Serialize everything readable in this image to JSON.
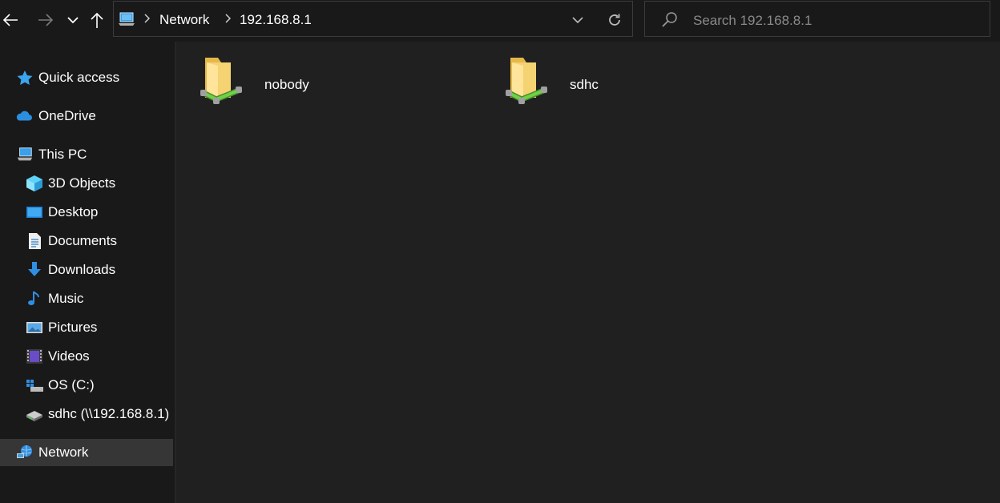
{
  "nav": {
    "back_icon": "back-arrow-icon",
    "forward_icon": "forward-arrow-icon",
    "recent_icon": "chevron-down-icon",
    "up_icon": "up-arrow-icon"
  },
  "address": {
    "icon": "network-pc-icon",
    "breadcrumbs": [
      "Network",
      "192.168.8.1"
    ],
    "dropdown_icon": "chevron-down-icon",
    "refresh_icon": "refresh-icon"
  },
  "search": {
    "placeholder": "Search 192.168.8.1",
    "icon": "search-icon"
  },
  "sidebar": {
    "items": [
      {
        "label": "Quick access",
        "icon": "star-icon"
      },
      {
        "label": "OneDrive",
        "icon": "cloud-icon"
      },
      {
        "label": "This PC",
        "icon": "computer-icon"
      },
      {
        "label": "3D Objects",
        "icon": "cube-icon"
      },
      {
        "label": "Desktop",
        "icon": "desktop-icon"
      },
      {
        "label": "Documents",
        "icon": "document-icon"
      },
      {
        "label": "Downloads",
        "icon": "download-icon"
      },
      {
        "label": "Music",
        "icon": "music-note-icon"
      },
      {
        "label": "Pictures",
        "icon": "pictures-icon"
      },
      {
        "label": "Videos",
        "icon": "film-icon"
      },
      {
        "label": "OS (C:)",
        "icon": "drive-icon"
      },
      {
        "label": "sdhc (\\\\192.168.8.1)",
        "icon": "network-drive-icon"
      },
      {
        "label": "Network",
        "icon": "network-globe-icon",
        "selected": true
      }
    ]
  },
  "content": {
    "items": [
      {
        "name": "nobody",
        "icon": "shared-folder-icon"
      },
      {
        "name": "sdhc",
        "icon": "shared-folder-icon"
      }
    ]
  },
  "colors": {
    "background": "#191919",
    "content_bg": "#202020",
    "selected_bg": "#363636",
    "border": "#3b3b3b",
    "text": "#ffffff",
    "placeholder": "#8a8a8a",
    "accent": "#1a9fff"
  }
}
